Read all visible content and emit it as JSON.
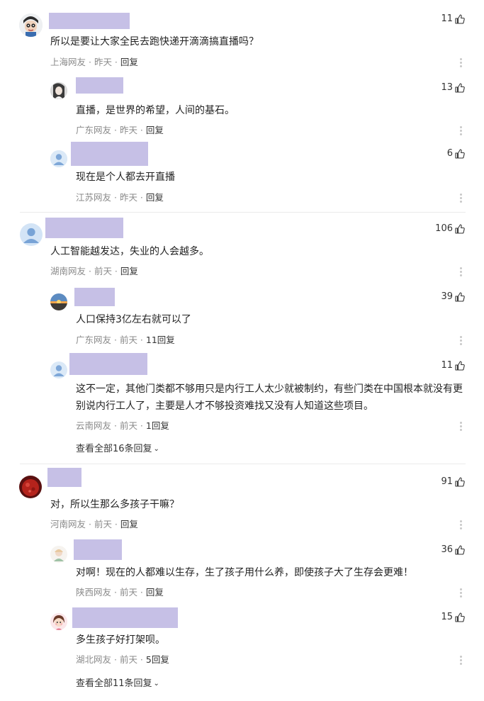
{
  "like_icon": "thumbs-up-icon",
  "more_icon": "more-vertical-icon",
  "colors": {
    "name_placeholder": "#c6c0e6",
    "meta": "#8a8a8a"
  },
  "threads": [
    {
      "top": {
        "text": "所以是要让大家全民去跑快递开滴滴搞直播吗？",
        "location": "上海网友",
        "time": "昨天",
        "reply": "回复",
        "likes": "11"
      },
      "replies": [
        {
          "text": "直播，是世界的希望，人间的基石。",
          "location": "广东网友",
          "time": "昨天",
          "reply": "回复",
          "likes": "13"
        },
        {
          "text": "现在是个人都去开直播",
          "location": "江苏网友",
          "time": "昨天",
          "reply": "回复",
          "likes": "6"
        }
      ]
    },
    {
      "top": {
        "text": "人工智能越发达，失业的人会越多。",
        "location": "湖南网友",
        "time": "前天",
        "reply": "回复",
        "likes": "106"
      },
      "replies": [
        {
          "text": "人口保持3亿左右就可以了",
          "location": "广东网友",
          "time": "前天",
          "reply": "11回复",
          "likes": "39"
        },
        {
          "text": "这不一定，其他门类都不够用只是内行工人太少就被制约，有些门类在中国根本就没有更别说内行工人了，主要是人才不够投资难找又没有人知道这些项目。",
          "location": "云南网友",
          "time": "前天",
          "reply": "1回复",
          "likes": "11"
        }
      ],
      "view_all": "查看全部16条回复"
    },
    {
      "top": {
        "text": "对，所以生那么多孩子干嘛？",
        "location": "河南网友",
        "time": "前天",
        "reply": "回复",
        "likes": "91"
      },
      "replies": [
        {
          "text": "对啊！现在的人都难以生存，生了孩子用什么养，即使孩子大了生存会更难！",
          "location": "陕西网友",
          "time": "前天",
          "reply": "回复",
          "likes": "36"
        },
        {
          "text": "多生孩子好打架呗。",
          "location": "湖北网友",
          "time": "前天",
          "reply": "5回复",
          "likes": "15"
        }
      ],
      "view_all": "查看全部11条回复"
    }
  ]
}
